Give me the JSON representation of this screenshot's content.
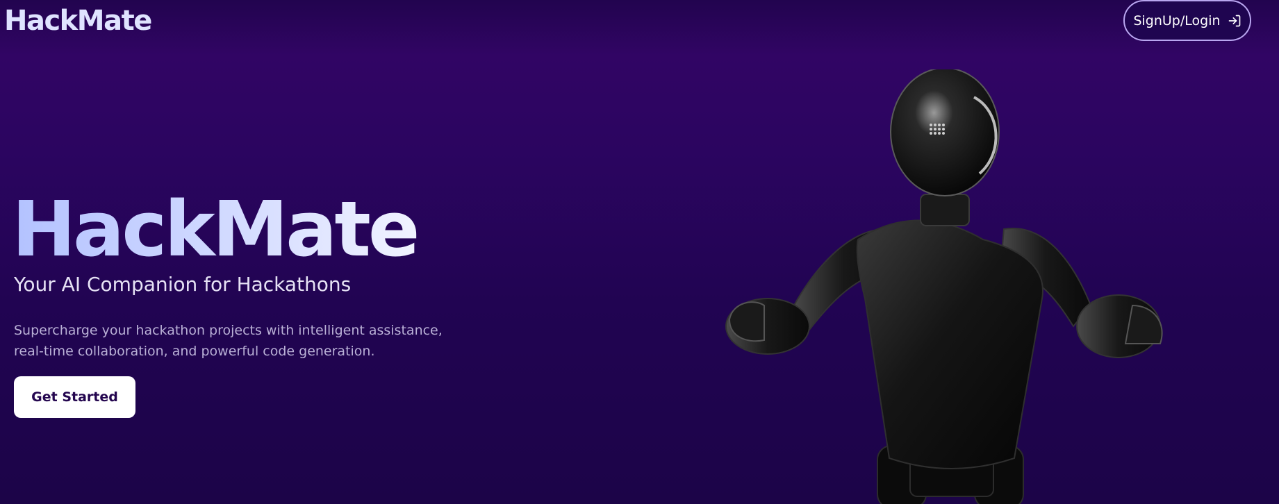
{
  "header": {
    "logo": "HackMate",
    "auth_button": {
      "label": "SignUp/Login",
      "icon": "login-arrow-icon"
    }
  },
  "hero": {
    "title": "HackMate",
    "subtitle": "Your AI Companion for Hackathons",
    "description_line1": "Supercharge your hackathon projects with intelligent assistance,",
    "description_line2": "real-time collaboration, and powerful code generation.",
    "cta_label": "Get Started"
  },
  "illustration": {
    "name": "robot-illustration"
  },
  "colors": {
    "background_top": "#310564",
    "background_bottom": "#1c0448",
    "accent_title": "#c7d1ff",
    "button_text": "#24064f"
  }
}
